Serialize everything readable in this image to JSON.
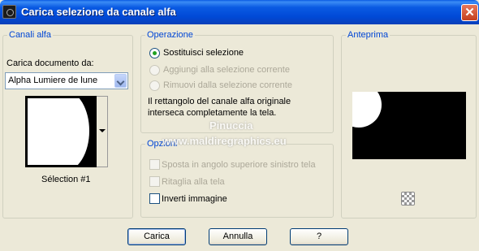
{
  "window": {
    "title": "Carica selezione da canale alfa",
    "close_symbol": "✕"
  },
  "canali": {
    "legend": "Canali alfa",
    "load_label": "Carica documento da:",
    "document_value": "Alpha Lumiere de lune",
    "selection_caption": "Sélection #1"
  },
  "operazione": {
    "legend": "Operazione",
    "options": [
      {
        "label": "Sostituisci selezione",
        "selected": true,
        "enabled": true
      },
      {
        "label": "Aggiungi alla selezione corrente",
        "selected": false,
        "enabled": false
      },
      {
        "label": "Rimuovi dalla selezione corrente",
        "selected": false,
        "enabled": false
      }
    ],
    "info_line1": "Il rettangolo del canale alfa originale",
    "info_line2": "interseca completamente la tela."
  },
  "opzioni": {
    "legend": "Opzioni",
    "checks": [
      {
        "label": "Sposta in angolo superiore sinistro tela",
        "checked": false,
        "enabled": false
      },
      {
        "label": "Ritaglia alla tela",
        "checked": false,
        "enabled": false
      },
      {
        "label": "Inverti immagine",
        "checked": false,
        "enabled": true
      }
    ]
  },
  "anteprima": {
    "legend": "Anteprima"
  },
  "watermark": {
    "line1": "Pinuccia",
    "line2": "www.maldiregraphics.eu"
  },
  "buttons": {
    "ok": "Carica",
    "cancel": "Annulla",
    "help": "?"
  }
}
